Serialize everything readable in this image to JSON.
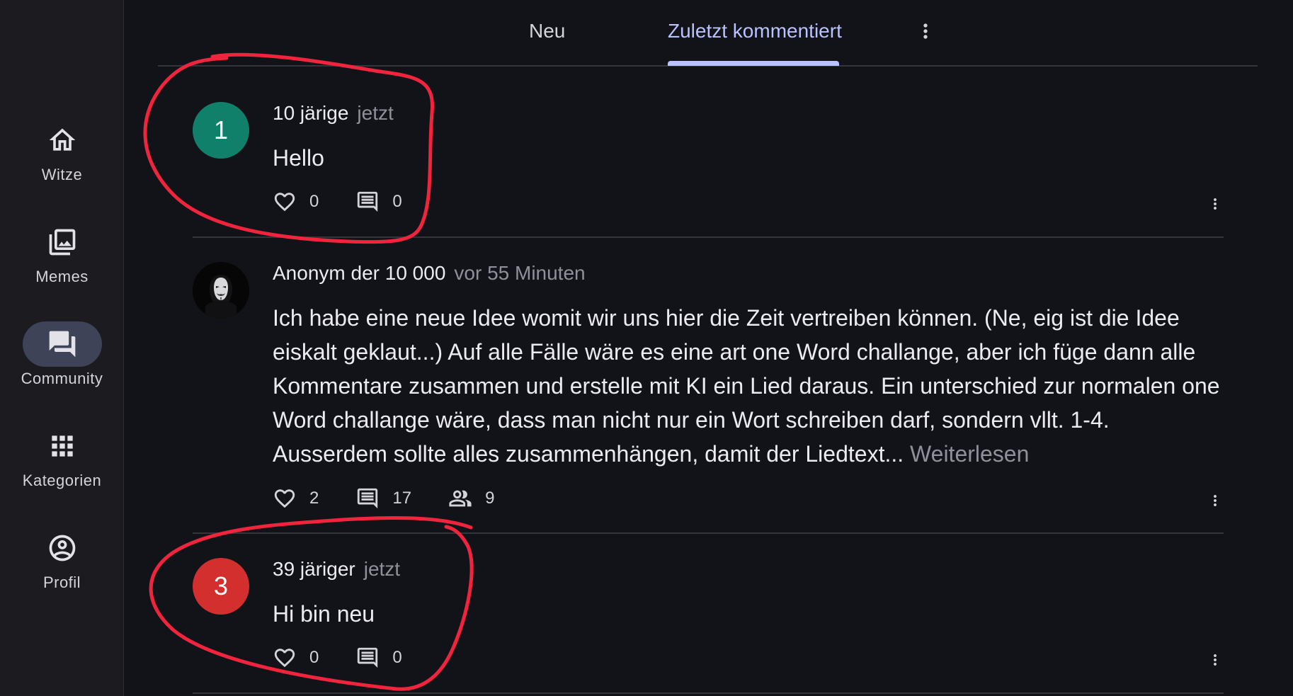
{
  "sidebar": {
    "items": [
      {
        "label": "Witze",
        "icon": "home-icon",
        "active": false
      },
      {
        "label": "Memes",
        "icon": "photo-library-icon",
        "active": false
      },
      {
        "label": "Community",
        "icon": "forum-icon",
        "active": true
      },
      {
        "label": "Kategorien",
        "icon": "grid-icon",
        "active": false
      },
      {
        "label": "Profil",
        "icon": "account-circle-icon",
        "active": false
      }
    ]
  },
  "tabs": [
    {
      "label": "Neu",
      "active": false
    },
    {
      "label": "Zuletzt kommentiert",
      "active": true
    }
  ],
  "posts": [
    {
      "avatar_text": "1",
      "avatar_color": "#11806a",
      "author": "10 järige",
      "time": "jetzt",
      "body": "Hello",
      "likes": "0",
      "comments": "0"
    },
    {
      "avatar_icon": "anonymous-mask-avatar",
      "author": "Anonym der 10 000",
      "time": "vor 55 Minuten",
      "body": "Ich habe eine neue Idee womit wir uns hier die Zeit vertreiben können. (Ne, eig ist die Idee eiskalt geklaut...) Auf alle Fälle wäre es eine art one Word challange, aber ich füge dann alle Kommentare zusammen und erstelle mit KI ein Lied daraus. Ein unterschied zur normalen one Word challange wäre, dass man nicht nur ein Wort schreiben darf, sondern vllt. 1-4. Ausserdem sollte alles zusammenhängen, damit der Liedtext...",
      "read_more": "Weiterlesen",
      "likes": "2",
      "comments": "17",
      "participants": "9"
    },
    {
      "avatar_text": "3",
      "avatar_color": "#d32f2f",
      "author": "39 järiger",
      "time": "jetzt",
      "body": "Hi bin neu",
      "likes": "0",
      "comments": "0"
    }
  ],
  "annotation_color": "#f0243c"
}
